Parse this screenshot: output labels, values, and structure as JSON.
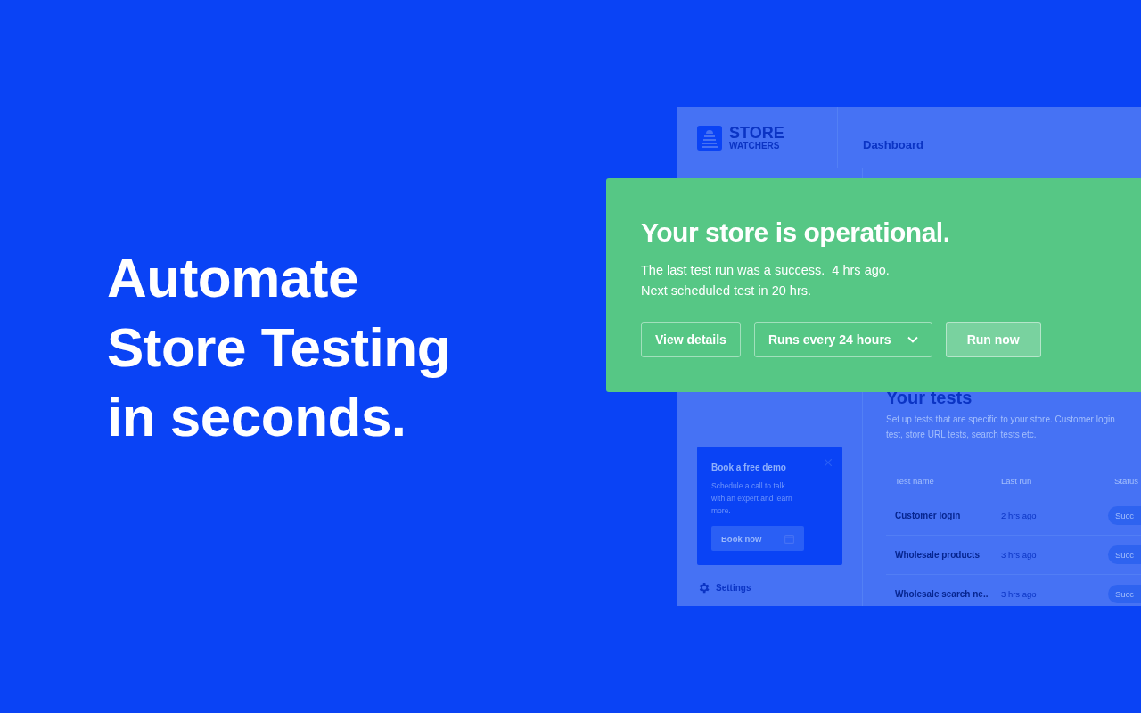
{
  "headline": {
    "lines": [
      "Automate",
      "Store Testing",
      "in seconds."
    ]
  },
  "app": {
    "logo": {
      "name": "STORE",
      "tagline": "WATCHERS"
    },
    "page_title": "Dashboard",
    "demo_card": {
      "title": "Book a free demo",
      "text": "Schedule a call to talk with an expert and learn more.",
      "button": "Book now"
    },
    "settings": "Settings",
    "tests": {
      "title": "Your tests",
      "description": "Set up tests that are specific to your store. Customer login test, store URL tests, search tests etc.",
      "columns": [
        "Test name",
        "Last run",
        "Status"
      ],
      "rows": [
        {
          "name": "Customer login",
          "last_run": "2 hrs ago",
          "status": "Succ"
        },
        {
          "name": "Wholesale products",
          "last_run": "3 hrs ago",
          "status": "Succ"
        },
        {
          "name": "Wholesale search ne..",
          "last_run": "3 hrs ago",
          "status": "Succ"
        }
      ]
    }
  },
  "status_card": {
    "title": "Your store is operational.",
    "lines": [
      "The last test run was a success.  4 hrs ago.",
      "Next scheduled test in 20 hrs."
    ],
    "buttons": [
      {
        "kind": "outline",
        "label": "View details"
      },
      {
        "kind": "dropdown",
        "label": "Runs every 24 hours"
      },
      {
        "kind": "primary",
        "label": "Run now"
      }
    ]
  }
}
